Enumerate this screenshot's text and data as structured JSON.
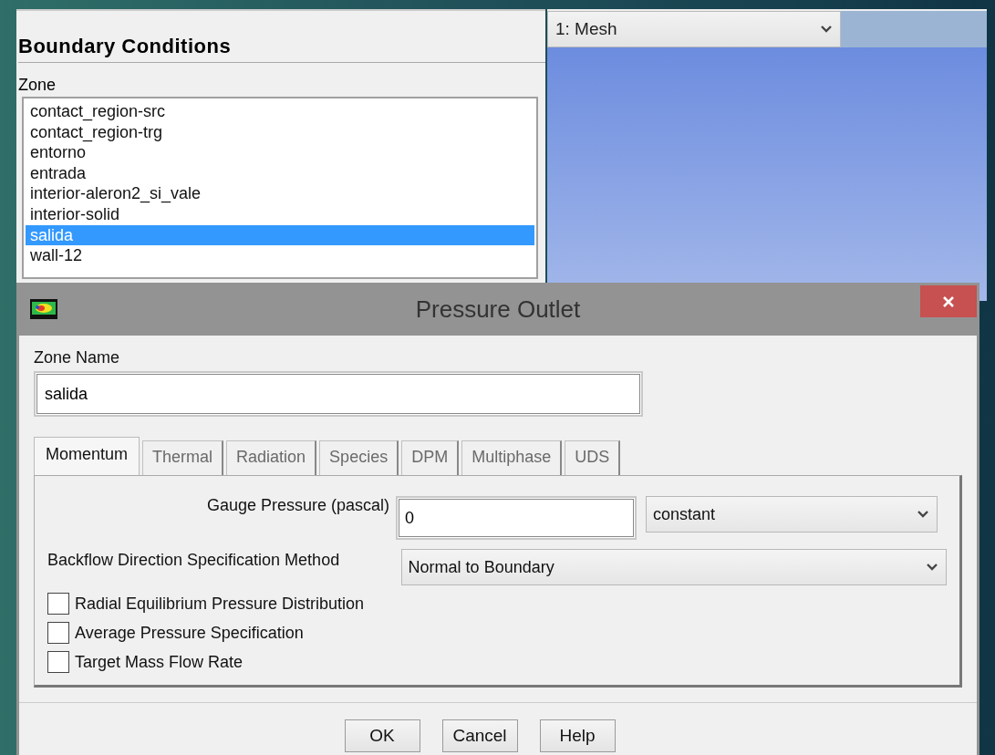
{
  "main_window": {
    "boundary_conditions": {
      "title": "Boundary Conditions",
      "zone_label": "Zone",
      "zones": [
        {
          "name": "contact_region-src",
          "selected": false
        },
        {
          "name": "contact_region-trg",
          "selected": false
        },
        {
          "name": "entorno",
          "selected": false
        },
        {
          "name": "entrada",
          "selected": false
        },
        {
          "name": "interior-aleron2_si_vale",
          "selected": false
        },
        {
          "name": "interior-solid",
          "selected": false
        },
        {
          "name": "salida",
          "selected": true
        },
        {
          "name": "wall-12",
          "selected": false
        }
      ]
    },
    "viewport": {
      "view_select": "1: Mesh"
    }
  },
  "dialog": {
    "title": "Pressure Outlet",
    "zone_name_label": "Zone Name",
    "zone_name": "salida",
    "tabs": [
      {
        "label": "Momentum",
        "selected": true
      },
      {
        "label": "Thermal",
        "selected": false
      },
      {
        "label": "Radiation",
        "selected": false
      },
      {
        "label": "Species",
        "selected": false
      },
      {
        "label": "DPM",
        "selected": false
      },
      {
        "label": "Multiphase",
        "selected": false
      },
      {
        "label": "UDS",
        "selected": false
      }
    ],
    "gauge_pressure": {
      "label": "Gauge Pressure (pascal)",
      "value": "0",
      "profile": "constant"
    },
    "backflow_method": {
      "label": "Backflow Direction Specification Method",
      "value": "Normal to Boundary"
    },
    "checkboxes": [
      {
        "label": "Radial Equilibrium Pressure Distribution",
        "checked": false
      },
      {
        "label": "Average Pressure Specification",
        "checked": false
      },
      {
        "label": "Target Mass Flow Rate",
        "checked": false
      }
    ],
    "buttons": [
      "OK",
      "Cancel",
      "Help"
    ]
  }
}
